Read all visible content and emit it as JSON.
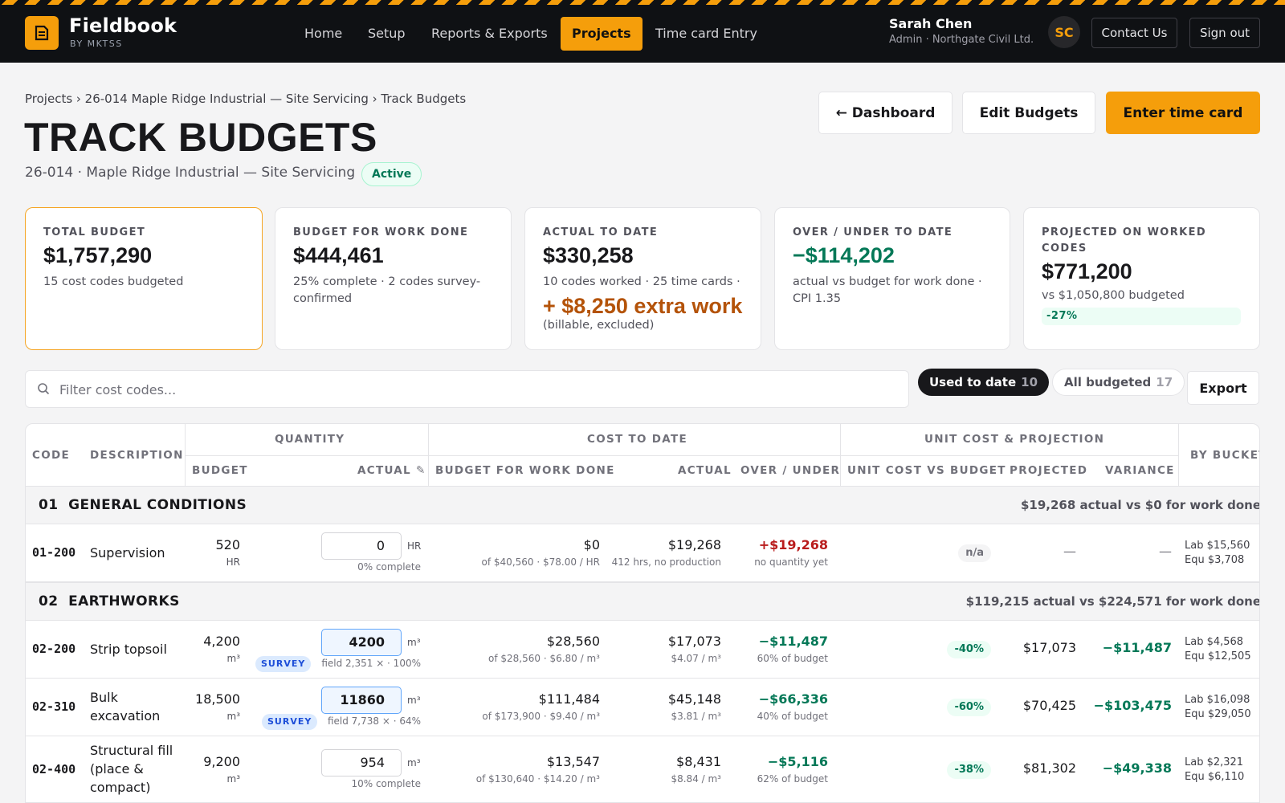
{
  "app": {
    "name": "Fieldbook",
    "sub": "BY MKTSS"
  },
  "nav": [
    {
      "label": "Home"
    },
    {
      "label": "Setup"
    },
    {
      "label": "Reports & Exports"
    },
    {
      "label": "Projects"
    },
    {
      "label": "Time card Entry"
    }
  ],
  "user": {
    "name": "Sarah Chen",
    "role": "Admin · Northgate Civil Ltd.",
    "initials": "SC"
  },
  "top_buttons": {
    "contact": "Contact Us",
    "signout": "Sign out"
  },
  "breadcrumb": "Projects › 26-014 Maple Ridge Industrial — Site Servicing › Track Budgets",
  "page": {
    "title": "TRACK BUDGETS",
    "subtitle": "26-014 · Maple Ridge Industrial — Site Servicing",
    "status": "Active"
  },
  "header_buttons": {
    "dashboard": "← Dashboard",
    "edit": "Edit Budgets",
    "enter": "Enter time card"
  },
  "cards": {
    "total": {
      "label": "TOTAL BUDGET",
      "value": "$1,757,290",
      "note": "15 cost codes budgeted"
    },
    "work_done": {
      "label": "BUDGET FOR WORK DONE",
      "value": "$444,461",
      "note": "25% complete · 2 codes survey-confirmed"
    },
    "actual": {
      "label": "ACTUAL TO DATE",
      "value": "$330,258",
      "note": "10 codes worked · 25 time cards ·",
      "extra": "+ $8,250 extra work",
      "extra_sub": "(billable, excluded)"
    },
    "over_under": {
      "label": "OVER / UNDER TO DATE",
      "value": "−$114,202",
      "note": "actual vs budget for work done · CPI 1.35"
    },
    "projected": {
      "label": "PROJECTED ON WORKED CODES",
      "value": "$771,200",
      "note": "vs $1,050,800 budgeted",
      "pct": "-27%"
    }
  },
  "filter": {
    "placeholder": "Filter cost codes...",
    "used_label": "Used to date",
    "used_count": "10",
    "all_label": "All budgeted",
    "all_count": "17",
    "export": "Export"
  },
  "table": {
    "headers": {
      "code": "CODE",
      "description": "DESCRIPTION",
      "quantity": "QUANTITY",
      "cost_to_date": "COST TO DATE",
      "unit_cost": "UNIT COST & PROJECTION",
      "by_bucket": "BY BUCKET",
      "budget": "BUDGET",
      "actual_edit": "ACTUAL ✎",
      "budget_work_done": "BUDGET FOR WORK DONE",
      "actual": "ACTUAL",
      "over_under": "OVER / UNDER",
      "unit_vs_budget": "UNIT COST VS BUDGET",
      "projected": "PROJECTED",
      "variance": "VARIANCE"
    },
    "sections": [
      {
        "number": "01",
        "title": "GENERAL CONDITIONS",
        "summary": "$19,268 actual vs $0 for work done"
      },
      {
        "number": "02",
        "title": "EARTHWORKS",
        "summary": "$119,215 actual vs $224,571 for work done"
      }
    ],
    "rows": [
      {
        "code": "01-200",
        "desc": [
          "Supervision"
        ],
        "budget_qty": "520",
        "budget_unit": "HR",
        "actual_qty": "0",
        "actual_unit": "HR",
        "qty_note": "0% complete",
        "bwd": "$0",
        "bwd_sub": "of $40,560 · $78.00 / HR",
        "actual": "$19,268",
        "actual_sub": "412 hrs, no production",
        "ou": "+$19,268",
        "ou_sub": "no quantity yet",
        "unit_vs": "n/a",
        "projected": "—",
        "variance": "—",
        "lab": "Lab $15,560",
        "equ": "Equ $3,708"
      },
      {
        "code": "02-200",
        "desc": [
          "Strip topsoil"
        ],
        "budget_qty": "4,200",
        "budget_unit": "m³",
        "actual_qty": "4200",
        "actual_unit": "m³",
        "survey": "SURVEY",
        "qty_note": "field 2,351 × · 100%",
        "bwd": "$28,560",
        "bwd_sub": "of $28,560 · $6.80 / m³",
        "actual": "$17,073",
        "actual_sub": "$4.07 / m³",
        "ou": "−$11,487",
        "ou_sub": "60% of budget",
        "unit_vs": "-40%",
        "projected": "$17,073",
        "variance": "−$11,487",
        "lab": "Lab $4,568",
        "equ": "Equ $12,505"
      },
      {
        "code": "02-310",
        "desc": [
          "Bulk",
          "excavation"
        ],
        "budget_qty": "18,500",
        "budget_unit": "m³",
        "actual_qty": "11860",
        "actual_unit": "m³",
        "survey": "SURVEY",
        "qty_note": "field 7,738 × · 64%",
        "bwd": "$111,484",
        "bwd_sub": "of $173,900 · $9.40 / m³",
        "actual": "$45,148",
        "actual_sub": "$3.81 / m³",
        "ou": "−$66,336",
        "ou_sub": "40% of budget",
        "unit_vs": "-60%",
        "projected": "$70,425",
        "variance": "−$103,475",
        "lab": "Lab $16,098",
        "equ": "Equ $29,050"
      },
      {
        "code": "02-400",
        "desc": [
          "Structural fill",
          "(place &",
          "compact)"
        ],
        "budget_qty": "9,200",
        "budget_unit": "m³",
        "actual_qty": "954",
        "actual_unit": "m³",
        "qty_note": "10% complete",
        "bwd": "$13,547",
        "bwd_sub": "of $130,640 · $14.20 / m³",
        "actual": "$8,431",
        "actual_sub": "$8.84 / m³",
        "ou": "−$5,116",
        "ou_sub": "62% of budget",
        "unit_vs": "-38%",
        "projected": "$81,302",
        "variance": "−$49,338",
        "lab": "Lab $2,321",
        "equ": "Equ $6,110"
      }
    ]
  }
}
